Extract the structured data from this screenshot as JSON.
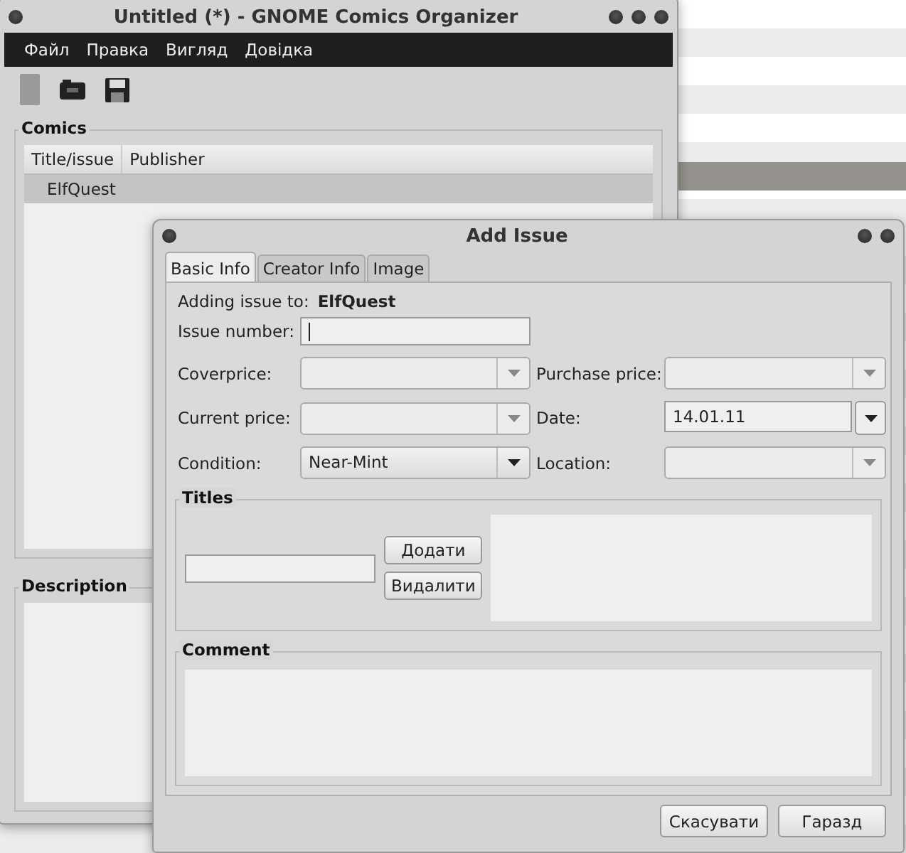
{
  "main_window": {
    "title": "Untitled (*) - GNOME Comics Organizer",
    "menu": [
      "Файл",
      "Правка",
      "Вигляд",
      "Довідка"
    ],
    "comics": {
      "label": "Comics",
      "columns": [
        "Title/issue",
        "Publisher"
      ],
      "rows": [
        {
          "title": "ElfQuest",
          "selected": true
        }
      ]
    },
    "description": {
      "label": "Description"
    }
  },
  "dialog": {
    "title": "Add Issue",
    "tabs": [
      {
        "label": "Basic Info",
        "selected": true
      },
      {
        "label": "Creator Info",
        "selected": false
      },
      {
        "label": "Image",
        "selected": false
      }
    ],
    "adding_label": "Adding issue to:",
    "adding_value": "ElfQuest",
    "fields": [
      {
        "label": "Issue number:",
        "kind": "entry"
      },
      {
        "label": "Coverprice:",
        "kind": "combo-entry"
      },
      {
        "label": "Purchase price:",
        "kind": "combo-entry"
      },
      {
        "label": "Current price:",
        "kind": "combo-entry"
      },
      {
        "label": "Date:",
        "kind": "date",
        "value": "14.01.11"
      },
      {
        "label": "Condition:",
        "kind": "combo",
        "value": "Near-Mint"
      },
      {
        "label": "Location:",
        "kind": "combo-entry"
      }
    ],
    "titles": {
      "label": "Titles",
      "buttons": [
        "Додати",
        "Видалити"
      ]
    },
    "comment": {
      "label": "Comment"
    },
    "buttons": [
      "Скасувати",
      "Гаразд"
    ]
  }
}
